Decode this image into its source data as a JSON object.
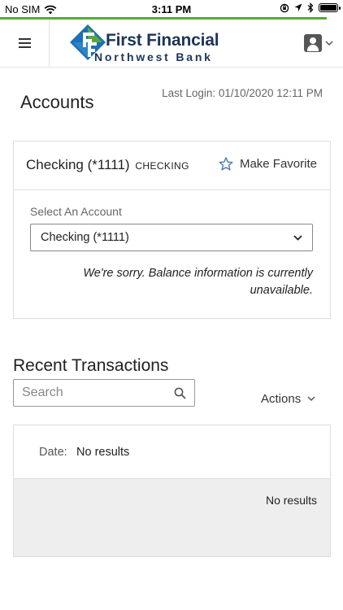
{
  "status_bar": {
    "carrier": "No SIM",
    "time": "3:11 PM",
    "icons": [
      "wifi-icon",
      "orientation-lock-icon",
      "location-icon",
      "bluetooth-icon",
      "battery-icon"
    ]
  },
  "header": {
    "menu_icon": "hamburger-menu-icon",
    "logo": {
      "title": "First Financial",
      "subtitle": "Northwest Bank",
      "colors": [
        "#1d6fb8",
        "#58a83b",
        "#1d3557"
      ]
    },
    "profile_icon": "user-icon"
  },
  "page": {
    "title": "Accounts",
    "last_login": "Last Login: 01/10/2020 12:11 PM"
  },
  "account": {
    "name": "Checking (*1111)",
    "type": "CHECKING",
    "favorite_label": "Make Favorite",
    "select_label": "Select An Account",
    "selected_account": "Checking (*1111)",
    "balance_message": "We're sorry. Balance information is currently unavailable."
  },
  "transactions": {
    "title": "Recent Transactions",
    "search_placeholder": "Search",
    "actions_label": "Actions",
    "date_label": "Date:",
    "date_value": "No results",
    "empty_message": "No results"
  },
  "colors": {
    "accent_green": "#58a83b",
    "brand_blue": "#1d6fb8",
    "brand_navy": "#1d3557",
    "star_blue": "#4a78b5"
  }
}
